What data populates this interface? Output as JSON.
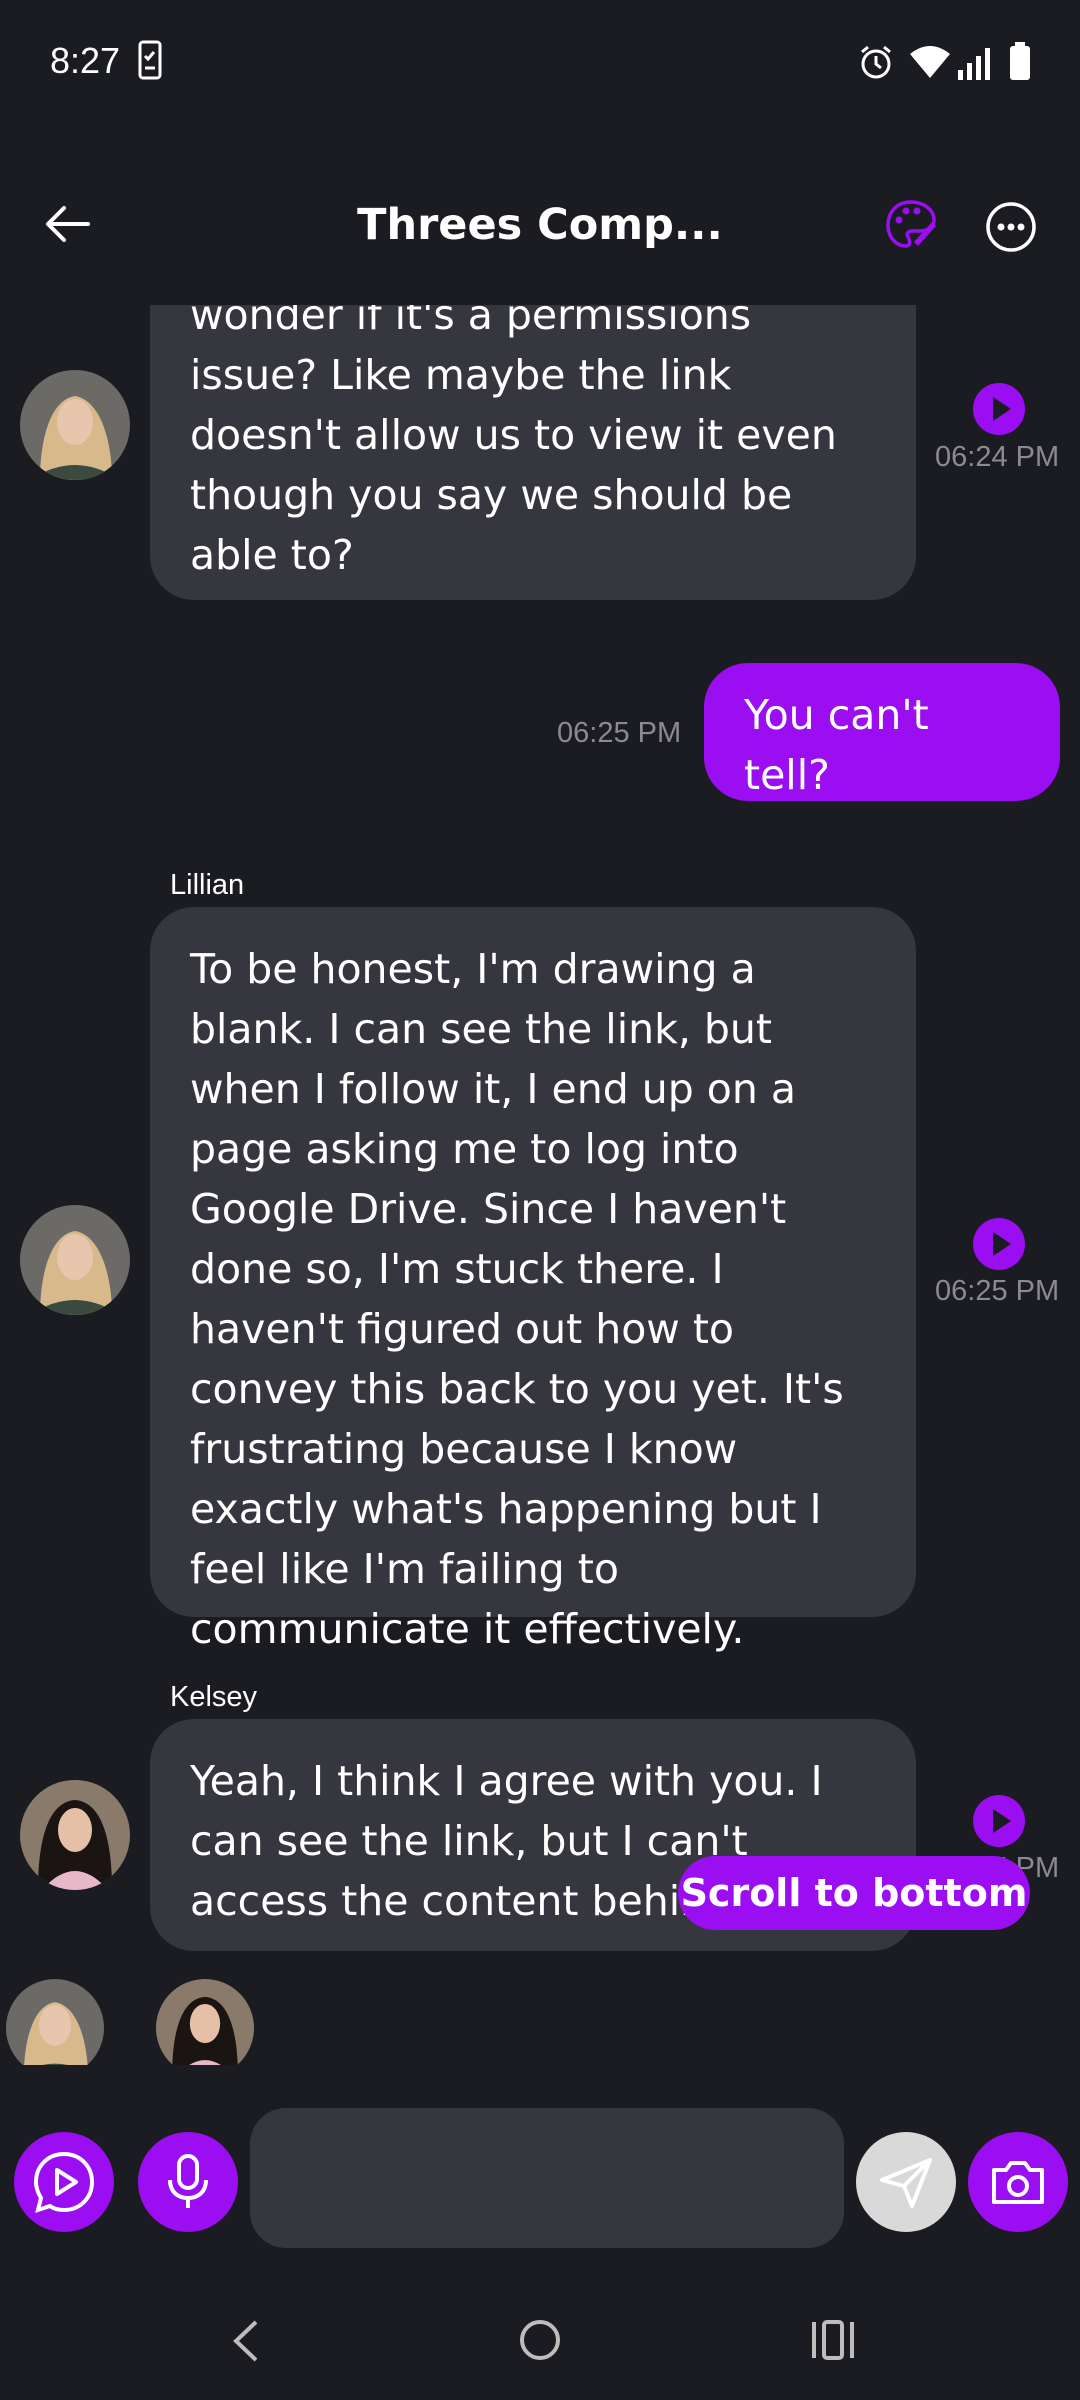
{
  "status_bar": {
    "time": "8:27"
  },
  "header": {
    "title": "Threes Comp...",
    "back_icon": "arrow-left-icon",
    "palette_icon": "palette-icon",
    "menu_icon": "more-horizontal-icon"
  },
  "messages": [
    {
      "sender": "",
      "text": "Hmmm that's really weird. I wonder if it's a permissions issue? Like maybe the link doesn't allow us to view it even though you say we should be able to?",
      "time": "06:24 PM"
    },
    {
      "sender": "me",
      "text": "You can't tell?",
      "time": "06:25 PM"
    },
    {
      "sender": "Lillian",
      "text": "To be honest, I'm drawing a blank. I can see the link, but when I follow it, I end up on a page asking me to log into Google Drive. Since I haven't done so, I'm stuck there. I haven't figured out how to convey this back to you yet. It's frustrating because I know exactly what's happening but I feel like I'm failing to communicate it effectively.",
      "time": "06:25 PM"
    },
    {
      "sender": "Kelsey",
      "text": "Yeah, I think I agree with you. I can see the link, but I can't access the content behind it.",
      "time": "06:25 PM"
    }
  ],
  "scroll_to_bottom_label": "Scroll to bottom",
  "input": {
    "placeholder": ""
  },
  "colors": {
    "accent": "#9b0ef2",
    "background": "#1b1c21",
    "bubble": "#36373e"
  }
}
